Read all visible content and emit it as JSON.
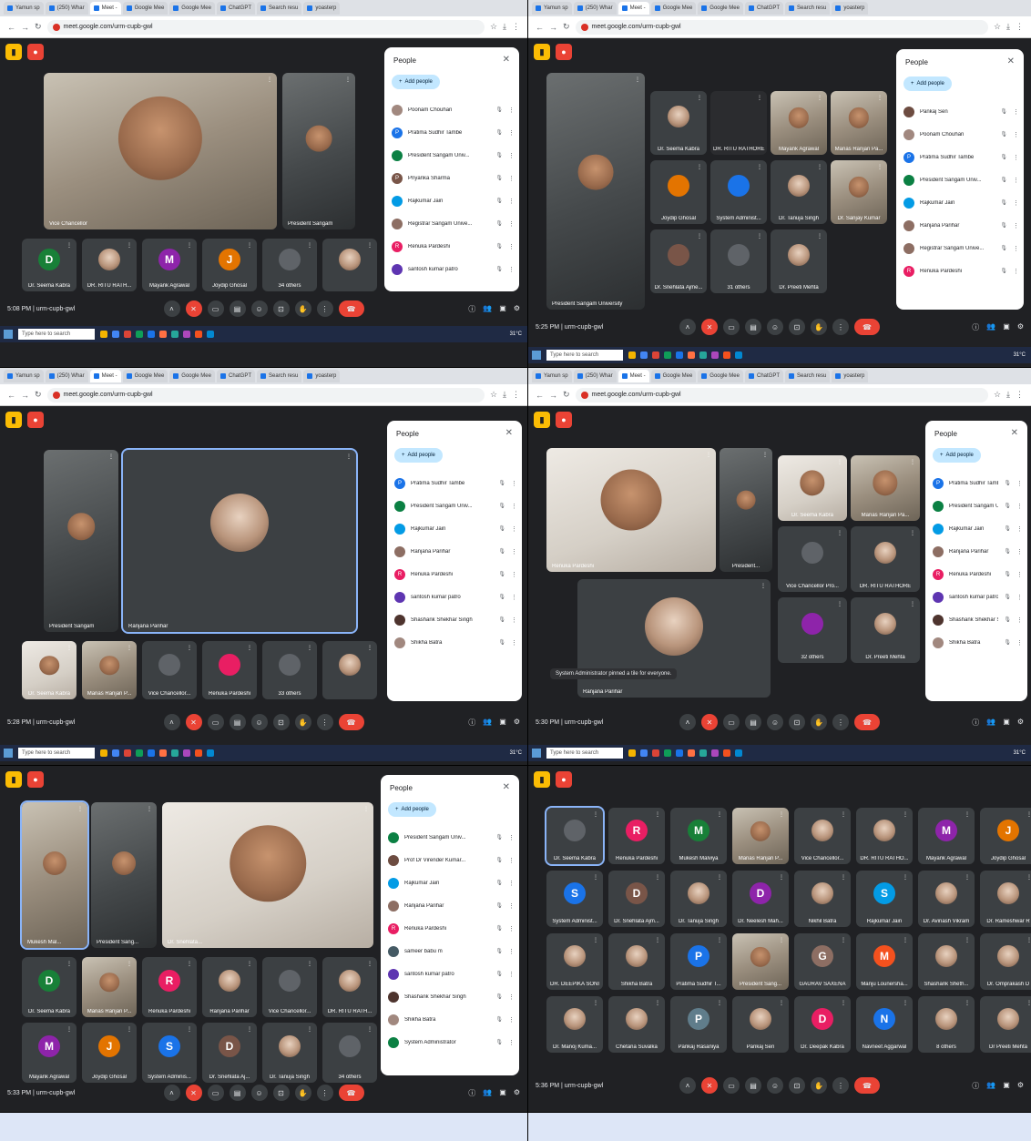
{
  "browser": {
    "tabs": [
      "Yamun sp",
      "(250) Whar",
      "Meet -",
      "Google Mee",
      "Google Mee",
      "ChatGPT",
      "Search resu",
      "yoasterp"
    ],
    "url": "meet.google.com/urm-cupb-gwl"
  },
  "meeting_code": "urm-cupb-gwl",
  "people_panel": {
    "title": "People",
    "add_label": "Add people"
  },
  "taskbar": {
    "search_placeholder": "Type here to search",
    "weather": "31°C"
  },
  "colors": {
    "meet_bg": "#202124",
    "tile_bg": "#3c4043",
    "end_call_red": "#ea4335",
    "panel_accent": "#c2e7ff",
    "focus_blue": "#8ab4f8"
  },
  "screens": [
    {
      "time": "5:08 PM",
      "main_tiles": [
        {
          "name": "Vice Chancellor"
        },
        {
          "name": "President Sangam"
        }
      ],
      "strip": [
        {
          "name": "Dr. Seema Kabra",
          "avatar": "D",
          "color": "#188038"
        },
        {
          "name": "DR. RITU RATH...",
          "avatar": "",
          "color": ""
        },
        {
          "name": "Mayank Agrawal",
          "avatar": "M",
          "color": "#8e24aa"
        },
        {
          "name": "Joydip Ghosal",
          "avatar": "J",
          "color": "#e37400"
        },
        {
          "name": "34 others",
          "avatar": "",
          "color": ""
        },
        {
          "name": "",
          "avatar": "",
          "color": ""
        }
      ],
      "people": [
        {
          "name": "Poonam Chouhan",
          "avatar": "",
          "color": "#a1887f"
        },
        {
          "name": "Pratima Sudhir Tambe",
          "avatar": "P",
          "color": "#1a73e8"
        },
        {
          "name": "President Sangam Univ...",
          "avatar": "",
          "color": "#0b8043"
        },
        {
          "name": "Priyanka Sharma",
          "avatar": "P",
          "color": "#795548"
        },
        {
          "name": "Rajkumar Jain",
          "avatar": "",
          "color": "#039be5"
        },
        {
          "name": "Registrar Sangam Unive...",
          "avatar": "",
          "color": "#8d6e63"
        },
        {
          "name": "Renuka Pardeshi",
          "avatar": "R",
          "color": "#e91e63"
        },
        {
          "name": "santosh kumar patro",
          "avatar": "",
          "color": "#5e35b1"
        }
      ]
    },
    {
      "time": "5:25 PM",
      "main_tiles": [
        {
          "name": "President Sangam University"
        },
        {
          "name": "Dr. Seema Kabra"
        },
        {
          "name": "DR. RITU RATHORE"
        },
        {
          "name": "Mayank Agrawal"
        },
        {
          "name": "Manas Ranjan Pa..."
        },
        {
          "name": "Joydip Ghosal"
        },
        {
          "name": "System Administ..."
        },
        {
          "name": "Dr. Tanuja Singh"
        },
        {
          "name": "Dr. Sanjay Kumar"
        },
        {
          "name": "Dr. Snehlata Ajme..."
        },
        {
          "name": "31 others"
        },
        {
          "name": "Dr. Preeti Mehta"
        }
      ],
      "people": [
        {
          "name": "Pankaj Sen",
          "avatar": "",
          "color": "#6d4c41"
        },
        {
          "name": "Poonam Chouhan",
          "avatar": "",
          "color": "#a1887f"
        },
        {
          "name": "Pratima Sudhir Tambe",
          "avatar": "P",
          "color": "#1a73e8"
        },
        {
          "name": "President Sangam Univ...",
          "avatar": "",
          "color": "#0b8043"
        },
        {
          "name": "Rajkumar Jain",
          "avatar": "",
          "color": "#039be5"
        },
        {
          "name": "Ranjana Parihar",
          "avatar": "",
          "color": "#8d6e63"
        },
        {
          "name": "Registrar Sangam Unive...",
          "avatar": "",
          "color": "#8d6e63"
        },
        {
          "name": "Renuka Pardeshi",
          "avatar": "R",
          "color": "#e91e63"
        }
      ]
    },
    {
      "time": "5:28 PM",
      "main_tiles": [
        {
          "name": "President Sangam"
        },
        {
          "name": "Ranjana Parihar"
        }
      ],
      "strip": [
        {
          "name": "Dr. Seema Kabra"
        },
        {
          "name": "Manas Ranjan P..."
        },
        {
          "name": "Vice Chancellor..."
        },
        {
          "name": "Renuka Pardeshi"
        },
        {
          "name": "33 others"
        },
        {
          "name": ""
        }
      ],
      "people": [
        {
          "name": "Pratima Sudhir Tambe",
          "avatar": "P",
          "color": "#1a73e8"
        },
        {
          "name": "President Sangam Univ...",
          "avatar": "",
          "color": "#0b8043"
        },
        {
          "name": "Rajkumar Jain",
          "avatar": "",
          "color": "#039be5"
        },
        {
          "name": "Ranjana Parihar",
          "avatar": "",
          "color": "#8d6e63"
        },
        {
          "name": "Renuka Pardeshi",
          "avatar": "R",
          "color": "#e91e63"
        },
        {
          "name": "santosh kumar patro",
          "avatar": "",
          "color": "#5e35b1"
        },
        {
          "name": "Shashank Shekhar Singh",
          "avatar": "",
          "color": "#4e342e"
        },
        {
          "name": "Shikha Batra",
          "avatar": "",
          "color": "#a1887f"
        }
      ]
    },
    {
      "time": "5:30 PM",
      "main_tiles": [
        {
          "name": "Renuka Pardeshi"
        },
        {
          "name": "President..."
        },
        {
          "name": "Dr. Seema Kabra"
        },
        {
          "name": "Manas Ranjan Pa..."
        },
        {
          "name": "Vice Chancellor Pro..."
        },
        {
          "name": "DR. RITU RATHORE"
        },
        {
          "name": "32 others"
        },
        {
          "name": "Dr. Preeti Mehta"
        },
        {
          "name": "Ranjana Parihar"
        }
      ],
      "toast": "System Administrator pinned a tile for everyone.",
      "people": [
        {
          "name": "Pratima Sudhir Tambe",
          "avatar": "P",
          "color": "#1a73e8"
        },
        {
          "name": "President Sangam Univ...",
          "avatar": "",
          "color": "#0b8043"
        },
        {
          "name": "Rajkumar Jain",
          "avatar": "",
          "color": "#039be5"
        },
        {
          "name": "Ranjana Parihar",
          "avatar": "",
          "color": "#8d6e63"
        },
        {
          "name": "Renuka Pardeshi",
          "avatar": "R",
          "color": "#e91e63"
        },
        {
          "name": "santosh kumar patro",
          "avatar": "",
          "color": "#5e35b1"
        },
        {
          "name": "Shashank Shekhar Singh",
          "avatar": "",
          "color": "#4e342e"
        },
        {
          "name": "Shikha Batra",
          "avatar": "",
          "color": "#a1887f"
        }
      ]
    },
    {
      "time": "5:33 PM",
      "main_tiles": [
        {
          "name": "Mukesh Mal..."
        },
        {
          "name": "President Sang..."
        },
        {
          "name": "Dr. Snehlata..."
        }
      ],
      "strip": [
        {
          "name": "Dr. Seema Kabra",
          "avatar": "D",
          "color": "#188038"
        },
        {
          "name": "Manas Ranjan P...",
          "avatar": "",
          "color": ""
        },
        {
          "name": "Renuka Pardeshi",
          "avatar": "R",
          "color": "#e91e63"
        },
        {
          "name": "Ranjana Parihar",
          "avatar": "",
          "color": ""
        },
        {
          "name": "Vice Chancellor...",
          "avatar": "",
          "color": ""
        },
        {
          "name": "DR. RITU RATH...",
          "avatar": "",
          "color": ""
        },
        {
          "name": "Mayank Agrawal",
          "avatar": "M",
          "color": "#8e24aa"
        },
        {
          "name": "Joydip Ghosal",
          "avatar": "J",
          "color": "#e37400"
        },
        {
          "name": "System Adminis...",
          "avatar": "S",
          "color": "#1a73e8"
        },
        {
          "name": "Dr. Snehlata Aj...",
          "avatar": "D",
          "color": "#795548"
        },
        {
          "name": "Dr. Tanuja Singh",
          "avatar": "",
          "color": ""
        },
        {
          "name": "34 others",
          "avatar": "",
          "color": ""
        }
      ],
      "people": [
        {
          "name": "President Sangam Univ...",
          "avatar": "",
          "color": "#0b8043"
        },
        {
          "name": "Prof Dr Virender Kumar...",
          "avatar": "",
          "color": "#6d4c41"
        },
        {
          "name": "Rajkumar Jain",
          "avatar": "",
          "color": "#039be5"
        },
        {
          "name": "Ranjana Parihar",
          "avatar": "",
          "color": "#8d6e63"
        },
        {
          "name": "Renuka Pardeshi",
          "avatar": "R",
          "color": "#e91e63"
        },
        {
          "name": "sameer babu m",
          "avatar": "",
          "color": "#455a64"
        },
        {
          "name": "santosh kumar patro",
          "avatar": "",
          "color": "#5e35b1"
        },
        {
          "name": "Shashank Shekhar Singh",
          "avatar": "",
          "color": "#4e342e"
        },
        {
          "name": "Shikha Batra",
          "avatar": "",
          "color": "#a1887f"
        },
        {
          "name": "System Administrator",
          "avatar": "",
          "color": "#0b8043"
        }
      ]
    },
    {
      "time": "5:36 PM",
      "grid": [
        {
          "name": "Dr. Seema Kabra",
          "avatar": "",
          "color": ""
        },
        {
          "name": "Renuka Pardeshi",
          "avatar": "R",
          "color": "#e91e63"
        },
        {
          "name": "Mukesh Malviya",
          "avatar": "M",
          "color": "#188038"
        },
        {
          "name": "Manas Ranjan P...",
          "avatar": "",
          "color": ""
        },
        {
          "name": "Vice Chancellor...",
          "avatar": "",
          "color": ""
        },
        {
          "name": "DR. RITU RATHO...",
          "avatar": "",
          "color": ""
        },
        {
          "name": "Mayank Agrawal",
          "avatar": "M",
          "color": "#8e24aa"
        },
        {
          "name": "Joydip Ghosal",
          "avatar": "J",
          "color": "#e37400"
        },
        {
          "name": "System Administ...",
          "avatar": "S",
          "color": "#1a73e8"
        },
        {
          "name": "Dr. Snehlata Ajm...",
          "avatar": "D",
          "color": "#795548"
        },
        {
          "name": "Dr. Tanuja Singh",
          "avatar": "",
          "color": ""
        },
        {
          "name": "Dr. Neelesh Mah...",
          "avatar": "D",
          "color": "#8e24aa"
        },
        {
          "name": "Nikhil Batra",
          "avatar": "",
          "color": ""
        },
        {
          "name": "Rajkumar Jain",
          "avatar": "S",
          "color": "#039be5"
        },
        {
          "name": "Dr. Avinash Vikram",
          "avatar": "",
          "color": ""
        },
        {
          "name": "Dr. Rameshwar R",
          "avatar": "",
          "color": ""
        },
        {
          "name": "DR. DEEPIKA SONI",
          "avatar": "",
          "color": ""
        },
        {
          "name": "Shikha Batra",
          "avatar": "",
          "color": ""
        },
        {
          "name": "Pratima Sudhir T...",
          "avatar": "P",
          "color": "#1a73e8"
        },
        {
          "name": "President Sang...",
          "avatar": "",
          "color": ""
        },
        {
          "name": "GAURAV SAXENA",
          "avatar": "G",
          "color": "#8d6e63"
        },
        {
          "name": "Manju Lounersha...",
          "avatar": "M",
          "color": "#f4511e"
        },
        {
          "name": "Shashank Sheth...",
          "avatar": "",
          "color": ""
        },
        {
          "name": "Dr. Omprakash D",
          "avatar": "",
          "color": ""
        },
        {
          "name": "Dr. Manoj Kuma...",
          "avatar": "",
          "color": ""
        },
        {
          "name": "Chetana Suvalka",
          "avatar": "",
          "color": ""
        },
        {
          "name": "Pankaj Rasaniya",
          "avatar": "P",
          "color": "#607d8b"
        },
        {
          "name": "Pankaj Sen",
          "avatar": "",
          "color": ""
        },
        {
          "name": "Dr. Deepak Kabra",
          "avatar": "D",
          "color": "#e91e63"
        },
        {
          "name": "Navneet Aggarwal",
          "avatar": "N",
          "color": "#1a73e8"
        },
        {
          "name": "8 others",
          "avatar": "",
          "color": ""
        },
        {
          "name": "Dr Preeti Mehta",
          "avatar": "",
          "color": ""
        }
      ]
    }
  ]
}
